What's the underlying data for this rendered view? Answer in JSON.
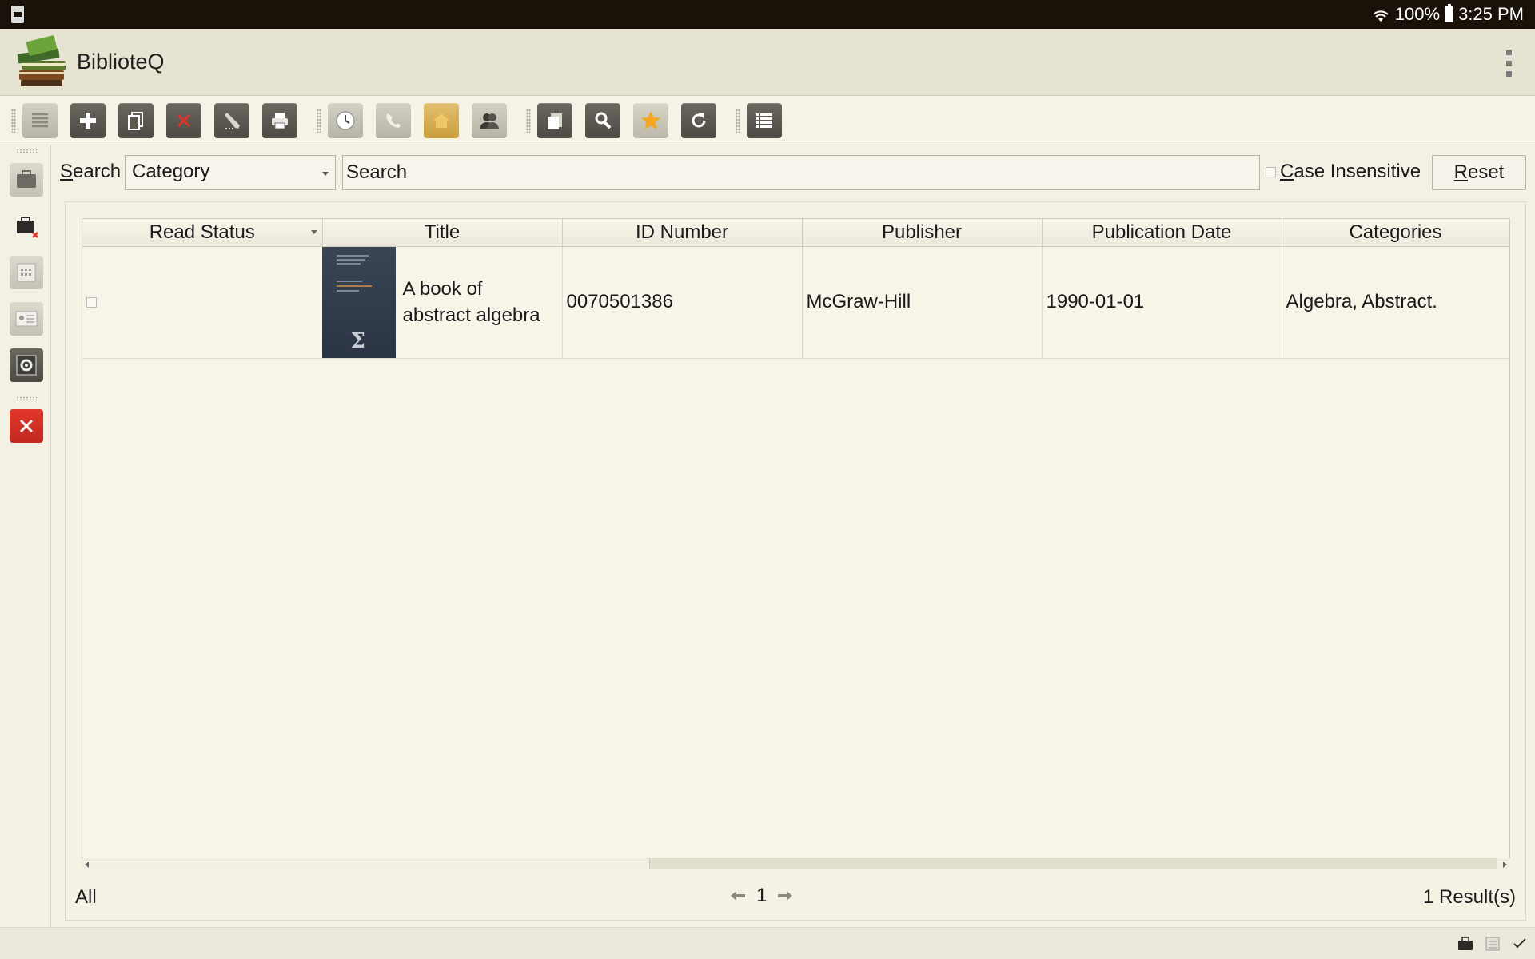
{
  "status_bar": {
    "battery_percent": "100%",
    "time": "3:25 PM",
    "sd_icon": "sd-card-icon",
    "wifi_icon": "wifi-icon",
    "battery_icon": "battery-icon"
  },
  "app": {
    "title": "BiblioteQ",
    "logo_icon": "books-logo-icon",
    "menu_icon": "overflow-menu-icon"
  },
  "toolbar": {
    "buttons": [
      {
        "name": "list-view-button",
        "icon": "list-icon"
      },
      {
        "name": "add-button",
        "icon": "plus-icon"
      },
      {
        "name": "duplicate-button",
        "icon": "copy-icon"
      },
      {
        "name": "delete-button",
        "icon": "delete-x-icon"
      },
      {
        "name": "modify-button",
        "icon": "pencil-icon"
      },
      {
        "name": "print-button",
        "icon": "printer-icon"
      },
      {
        "name": "reservations-button",
        "icon": "clock-icon"
      },
      {
        "name": "contact-button",
        "icon": "phone-icon"
      },
      {
        "name": "home-button",
        "icon": "home-folder-icon"
      },
      {
        "name": "members-button",
        "icon": "members-icon"
      },
      {
        "name": "copy-items-button",
        "icon": "stack-icon"
      },
      {
        "name": "search-button",
        "icon": "magnifier-icon"
      },
      {
        "name": "favorites-button",
        "icon": "star-icon"
      },
      {
        "name": "refresh-button",
        "icon": "refresh-icon"
      },
      {
        "name": "details-list-button",
        "icon": "details-list-icon"
      }
    ]
  },
  "sidebar": {
    "buttons": [
      {
        "name": "connect-button",
        "icon": "briefcase-icon"
      },
      {
        "name": "disconnect-button",
        "icon": "briefcase-disconnect-icon"
      },
      {
        "name": "calendar-button",
        "icon": "calendar-icon"
      },
      {
        "name": "id-card-button",
        "icon": "id-card-icon"
      },
      {
        "name": "admin-button",
        "icon": "admin-settings-icon"
      },
      {
        "name": "exit-button",
        "icon": "exit-x-icon"
      }
    ]
  },
  "search": {
    "label": "Search",
    "label_accel": "S",
    "label_rest": "earch",
    "category_value": "Category",
    "input_placeholder": "Search",
    "case_insensitive_label": "Case Insensitive",
    "case_accel": "C",
    "case_rest": "ase Insensitive",
    "case_insensitive_checked": false,
    "reset_label": "Reset",
    "reset_accel": "R",
    "reset_rest": "eset"
  },
  "table": {
    "columns": [
      "Read Status",
      "Title",
      "ID Number",
      "Publisher",
      "Publication Date",
      "Categories"
    ],
    "rows": [
      {
        "read_status": false,
        "title": "A book of abstract algebra",
        "title_line1": "A book of",
        "title_line2": "abstract algebra",
        "id_number": "0070501386",
        "publisher": "McGraw-Hill",
        "publication_date": "1990-01-01",
        "categories": "Algebra, Abstract."
      }
    ]
  },
  "footer": {
    "filter_label": "All",
    "page": "1",
    "results": "1 Result(s)"
  },
  "bottom_bar": {
    "icons": [
      "connection-status-icon",
      "database-icon",
      "checkmark-icon"
    ]
  },
  "colors": {
    "background": "#f4f1e4",
    "statusbar": "#1a1209",
    "appbar": "#e6e3d3",
    "delete_red": "#d63a2a",
    "star_orange": "#f5a623"
  }
}
